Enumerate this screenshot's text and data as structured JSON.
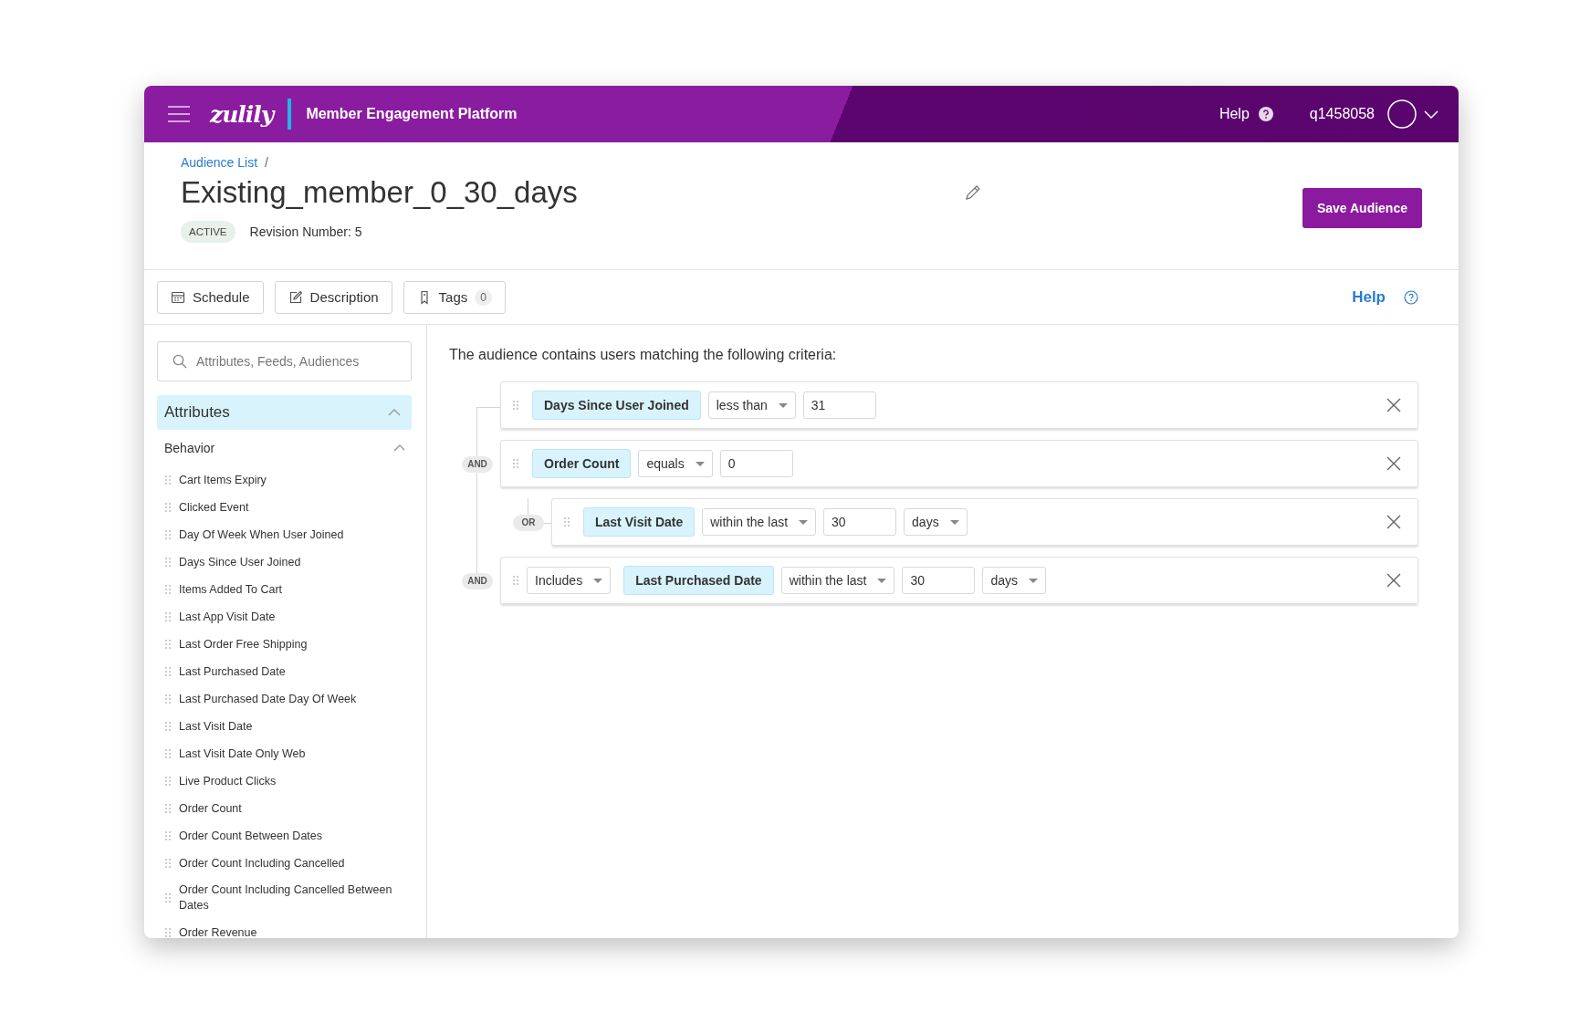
{
  "header": {
    "logo": "zulily",
    "title": "Member Engagement Platform",
    "help": "Help",
    "user": "q1458058"
  },
  "breadcrumb": {
    "link": "Audience List",
    "separator": "/"
  },
  "audience": {
    "name": "Existing_member_0_30_days",
    "status": "ACTIVE",
    "revision": "Revision Number: 5"
  },
  "save_button": "Save Audience",
  "toolbar": {
    "buttons": [
      {
        "kind": "schedule",
        "label": "Schedule"
      },
      {
        "kind": "description",
        "label": "Description"
      },
      {
        "kind": "tags",
        "label": "Tags",
        "count": "0"
      }
    ],
    "help": "Help"
  },
  "sidebar": {
    "search": {
      "placeholder": "Attributes, Feeds, Audiences"
    },
    "sections": [
      {
        "title": "Attributes",
        "expanded": true,
        "selected": true,
        "groups": [
          {
            "title": "Behavior",
            "expanded": true,
            "items": [
              "Cart Items Expiry",
              "Clicked Event",
              "Day Of Week When User Joined",
              "Days Since User Joined",
              "Items Added To Cart",
              "Last App Visit Date",
              "Last Order Free Shipping",
              "Last Purchased Date",
              "Last Purchased Date Day Of Week",
              "Last Visit Date",
              "Last Visit Date Only Web",
              "Live Product Clicks",
              "Order Count",
              "Order Count Between Dates",
              "Order Count Including Cancelled",
              "Order Count Including Cancelled Between Dates",
              "Order Revenue"
            ]
          }
        ]
      }
    ]
  },
  "builder": {
    "intro": "The audience contains users matching the following criteria:",
    "criteria": [
      {
        "items": [
          {
            "kind": "attribute",
            "label": "Days Since User Joined"
          },
          {
            "kind": "select",
            "value": "less than"
          },
          {
            "kind": "input",
            "value": "31"
          }
        ]
      },
      {
        "connector": "AND",
        "items": [
          {
            "kind": "attribute",
            "label": "Order Count"
          },
          {
            "kind": "select",
            "value": "equals"
          },
          {
            "kind": "input",
            "value": "0"
          }
        ],
        "children": [
          {
            "connector": "OR",
            "items": [
              {
                "kind": "attribute",
                "label": "Last Visit Date"
              },
              {
                "kind": "select",
                "value": "within the last"
              },
              {
                "kind": "input",
                "value": "30"
              },
              {
                "kind": "select",
                "value": "days"
              }
            ]
          }
        ]
      },
      {
        "connector": "AND",
        "items": [
          {
            "kind": "select",
            "value": "Includes"
          },
          {
            "kind": "attribute",
            "label": "Last Purchased Date"
          },
          {
            "kind": "select",
            "value": "within the last"
          },
          {
            "kind": "input",
            "value": "30"
          },
          {
            "kind": "select",
            "value": "days"
          }
        ]
      }
    ]
  }
}
